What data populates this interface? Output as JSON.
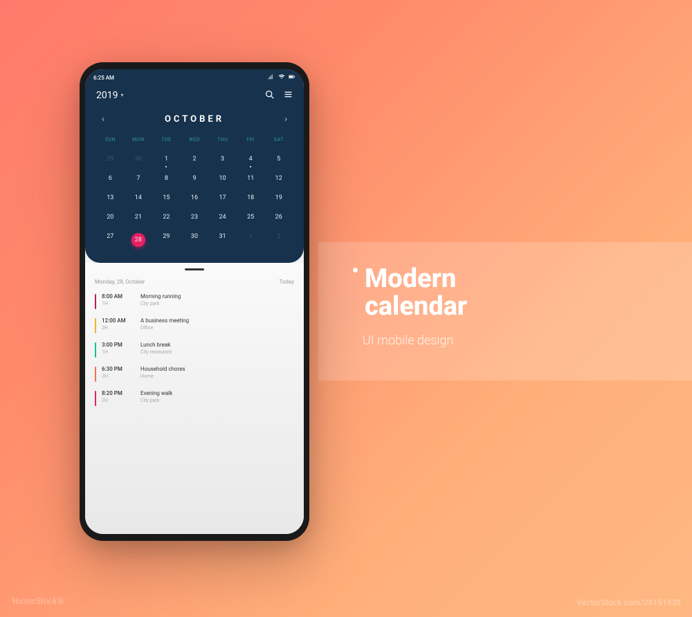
{
  "promo": {
    "title_line1": "Modern",
    "title_line2": "calendar",
    "subtitle": "UI mobile design"
  },
  "statusbar": {
    "time": "6:25 AM"
  },
  "header": {
    "year": "2019",
    "month": "OCTOBER"
  },
  "weekdays": [
    "SUN",
    "MON",
    "TUE",
    "WED",
    "THU",
    "FRI",
    "SAT"
  ],
  "calendar": {
    "rows": [
      [
        {
          "n": "29",
          "other": true
        },
        {
          "n": "30",
          "other": true
        },
        {
          "n": "1",
          "dot": true
        },
        {
          "n": "2"
        },
        {
          "n": "3"
        },
        {
          "n": "4",
          "dot": true
        },
        {
          "n": "5"
        }
      ],
      [
        {
          "n": "6"
        },
        {
          "n": "7"
        },
        {
          "n": "8"
        },
        {
          "n": "9"
        },
        {
          "n": "10"
        },
        {
          "n": "11"
        },
        {
          "n": "12"
        }
      ],
      [
        {
          "n": "13"
        },
        {
          "n": "14"
        },
        {
          "n": "15"
        },
        {
          "n": "16"
        },
        {
          "n": "17"
        },
        {
          "n": "18"
        },
        {
          "n": "19"
        }
      ],
      [
        {
          "n": "20"
        },
        {
          "n": "21"
        },
        {
          "n": "22"
        },
        {
          "n": "23"
        },
        {
          "n": "24"
        },
        {
          "n": "25"
        },
        {
          "n": "26"
        }
      ],
      [
        {
          "n": "27"
        },
        {
          "n": "28",
          "selected": true
        },
        {
          "n": "29"
        },
        {
          "n": "30"
        },
        {
          "n": "31"
        },
        {
          "n": "1",
          "other": true
        },
        {
          "n": "2",
          "other": true
        }
      ]
    ]
  },
  "agenda": {
    "date_label": "Monday, 28, October",
    "today_label": "Today",
    "events": [
      {
        "time": "8:00 AM",
        "duration": "1H",
        "title": "Morning running",
        "location": "City park",
        "color": "#c2185b"
      },
      {
        "time": "12:00 AM",
        "duration": "2H",
        "title": "A business meeting",
        "location": "Office",
        "color": "#f0b429"
      },
      {
        "time": "3:00 PM",
        "duration": "1H",
        "title": "Lunch break",
        "location": "City restaurant",
        "color": "#1abc9c"
      },
      {
        "time": "6:30 PM",
        "duration": "2H",
        "title": "Household chores",
        "location": "Home",
        "color": "#ff6b4a"
      },
      {
        "time": "8:20 PM",
        "duration": "2H",
        "title": "Evening walk",
        "location": "City park",
        "color": "#e91e63"
      }
    ]
  },
  "watermark": {
    "left": "VectorStock®",
    "right": "VectorStock.com/28151938"
  }
}
